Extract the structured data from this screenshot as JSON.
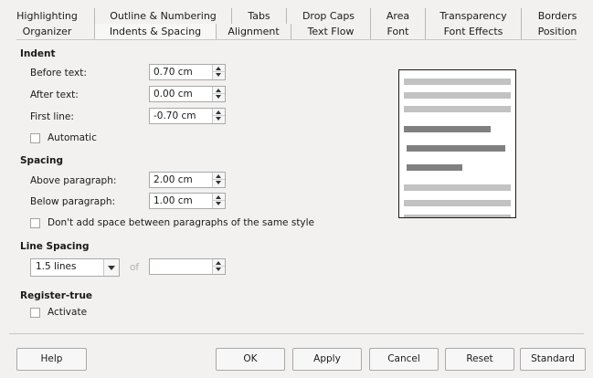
{
  "tabs_row1": [
    "Highlighting",
    "Outline & Numbering",
    "Tabs",
    "Drop Caps",
    "Area",
    "Transparency",
    "Borders"
  ],
  "tabs_row2": [
    "Organizer",
    "Indents & Spacing",
    "Alignment",
    "Text Flow",
    "Font",
    "Font Effects",
    "Position"
  ],
  "indent": {
    "title": "Indent",
    "before_label": "Before text:",
    "before_value": "0.70 cm",
    "after_label": "After text:",
    "after_value": "0.00 cm",
    "first_label": "First line:",
    "first_value": "-0.70 cm",
    "automatic_label": "Automatic"
  },
  "spacing": {
    "title": "Spacing",
    "above_label": "Above paragraph:",
    "above_value": "2.00 cm",
    "below_label": "Below paragraph:",
    "below_value": "1.00 cm",
    "dont_add_label": "Don't add space between paragraphs of the same style"
  },
  "line_spacing": {
    "title": "Line Spacing",
    "selected": "1.5 lines",
    "of_label": "of",
    "of_value": ""
  },
  "register_true": {
    "title": "Register-true",
    "activate_label": "Activate"
  },
  "buttons": {
    "help": "Help",
    "ok": "OK",
    "apply": "Apply",
    "cancel": "Cancel",
    "reset": "Reset",
    "standard": "Standard"
  },
  "colors": {
    "background": "#f2f1f0",
    "preview_light": "#c2c2c2",
    "preview_dark": "#808080"
  }
}
